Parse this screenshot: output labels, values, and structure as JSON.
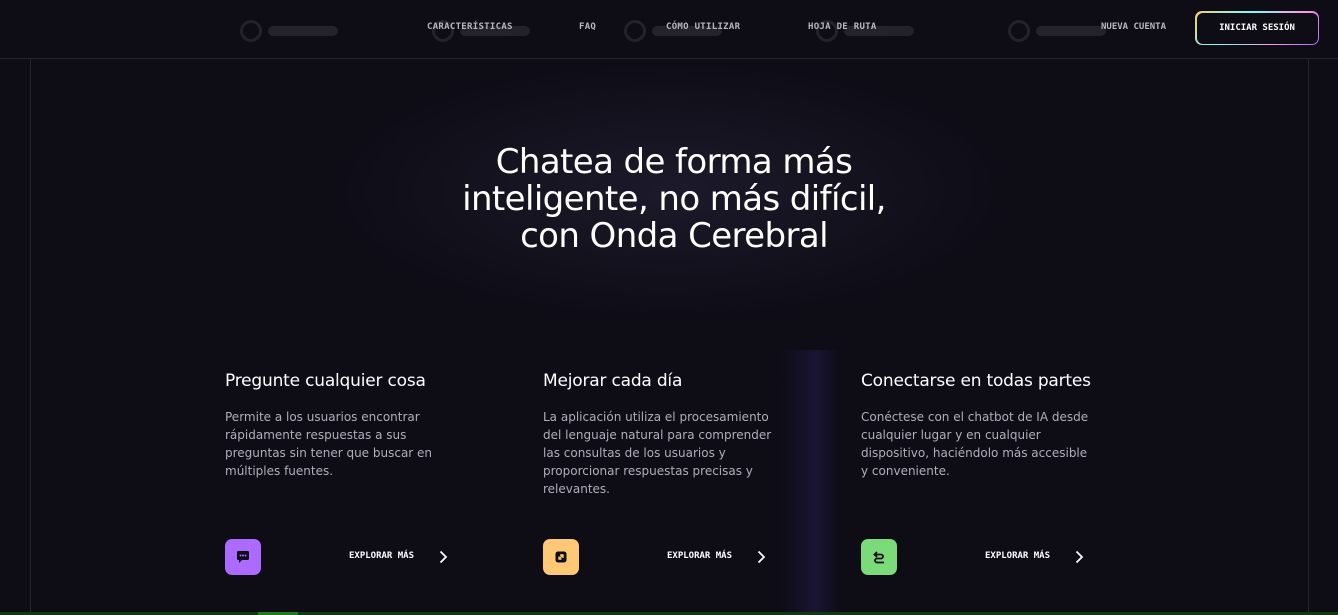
{
  "header": {
    "nav": [
      {
        "label": "CARACTERÍSTICAS"
      },
      {
        "label": "FAQ"
      },
      {
        "label": "CÓMO UTILIZAR"
      },
      {
        "label": "HOJA DE RUTA"
      }
    ],
    "new_account_label": "NUEVA CUENTA",
    "login_label": "INICIAR SESIÓN",
    "login_border_colors": [
      "#ffc876",
      "#79fff7",
      "#ff98e2",
      "#ac6aff"
    ]
  },
  "hero": {
    "title_line1": "Chatea de forma más",
    "title_line2": "inteligente, no más difícil,",
    "title_line3": "con Onda Cerebral"
  },
  "features": [
    {
      "title": "Pregunte cualquier cosa",
      "text": "Permite a los usuarios encontrar rápidamente respuestas a sus preguntas sin tener que buscar en múltiples fuentes.",
      "icon": "chat-bubble-icon",
      "icon_color": "#ac6aff",
      "explore_label": "EXPLORAR MÁS"
    },
    {
      "title": "Mejorar cada día",
      "text": "La aplicación utiliza el procesamiento del lenguaje natural para comprender las consultas de los usuarios y proporcionar respuestas precisas y relevantes.",
      "icon": "expand-arrow-icon",
      "icon_color": "#ffc876",
      "explore_label": "EXPLORAR MÁS"
    },
    {
      "title": "Conectarse en todas partes",
      "text": "Conéctese con el chatbot de IA desde cualquier lugar y en cualquier dispositivo, haciéndolo más accesible y conveniente.",
      "icon": "connect-icon",
      "icon_color": "#7adb78",
      "explore_label": "EXPLORAR MÁS"
    }
  ]
}
